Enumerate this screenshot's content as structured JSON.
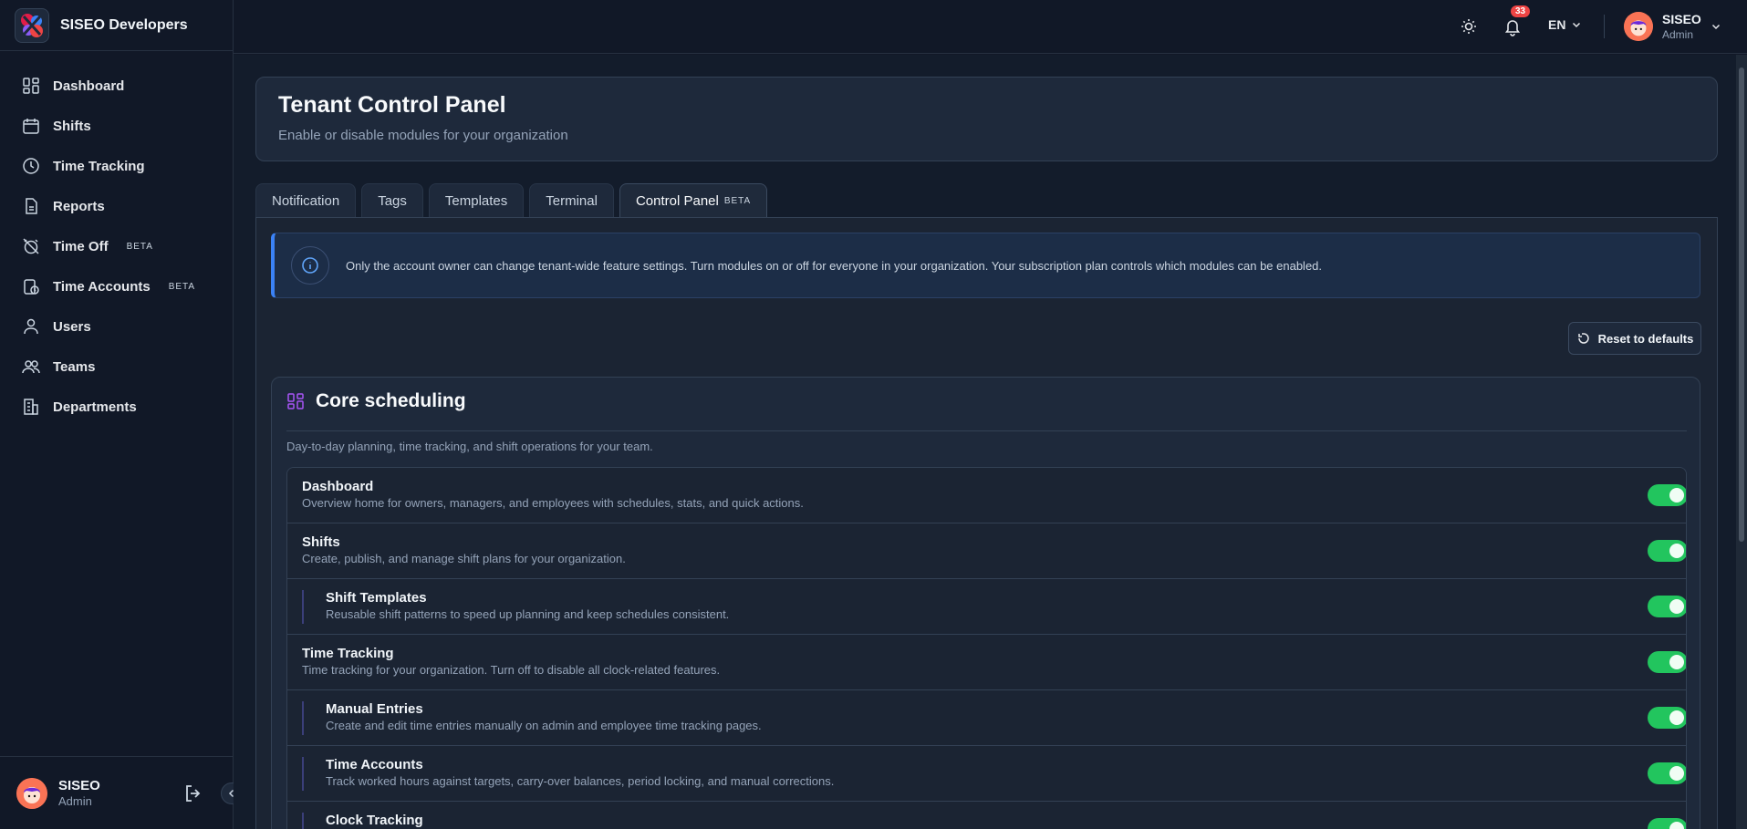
{
  "brand": {
    "name": "SISEO Developers"
  },
  "sidebar": {
    "items": [
      {
        "label": "Dashboard",
        "icon": "dashboard-icon",
        "beta": ""
      },
      {
        "label": "Shifts",
        "icon": "calendar-icon",
        "beta": ""
      },
      {
        "label": "Time Tracking",
        "icon": "clock-icon",
        "beta": ""
      },
      {
        "label": "Reports",
        "icon": "report-icon",
        "beta": ""
      },
      {
        "label": "Time Off",
        "icon": "alarm-off-icon",
        "beta": "BETA"
      },
      {
        "label": "Time Accounts",
        "icon": "time-account-icon",
        "beta": "BETA"
      },
      {
        "label": "Users",
        "icon": "user-icon",
        "beta": ""
      },
      {
        "label": "Teams",
        "icon": "team-icon",
        "beta": ""
      },
      {
        "label": "Departments",
        "icon": "building-icon",
        "beta": ""
      }
    ],
    "user": {
      "name": "SISEO",
      "role": "Admin"
    }
  },
  "header": {
    "notification_count": "33",
    "language": "EN",
    "user": {
      "name": "SISEO",
      "role": "Admin"
    }
  },
  "panel": {
    "title": "Tenant Control Panel",
    "subtitle": "Enable or disable modules for your organization"
  },
  "tabs": [
    {
      "label": "Notification",
      "beta": ""
    },
    {
      "label": "Tags",
      "beta": ""
    },
    {
      "label": "Templates",
      "beta": ""
    },
    {
      "label": "Terminal",
      "beta": ""
    },
    {
      "label": "Control Panel",
      "beta": "BETA"
    }
  ],
  "info": {
    "text": "Only the account owner can change tenant-wide feature settings. Turn modules on or off for everyone in your organization. Your subscription plan controls which modules can be enabled."
  },
  "reset_label": "Reset to defaults",
  "section": {
    "title": "Core scheduling",
    "description": "Day-to-day planning, time tracking, and shift operations for your team.",
    "modules": [
      {
        "name": "Dashboard",
        "description": "Overview home for owners, managers, and employees with schedules, stats, and quick actions.",
        "enabled": true,
        "child": false
      },
      {
        "name": "Shifts",
        "description": "Create, publish, and manage shift plans for your organization.",
        "enabled": true,
        "child": false
      },
      {
        "name": "Shift Templates",
        "description": "Reusable shift patterns to speed up planning and keep schedules consistent.",
        "enabled": true,
        "child": true
      },
      {
        "name": "Time Tracking",
        "description": "Time tracking for your organization. Turn off to disable all clock-related features.",
        "enabled": true,
        "child": false
      },
      {
        "name": "Manual Entries",
        "description": "Create and edit time entries manually on admin and employee time tracking pages.",
        "enabled": true,
        "child": true
      },
      {
        "name": "Time Accounts",
        "description": "Track worked hours against targets, carry-over balances, period locking, and manual corrections.",
        "enabled": true,
        "child": true
      },
      {
        "name": "Clock Tracking",
        "description": "",
        "enabled": true,
        "child": true
      }
    ]
  },
  "colors": {
    "accent": "#3b82f6",
    "toggle_on": "#22c55e",
    "badge": "#ef4444"
  }
}
